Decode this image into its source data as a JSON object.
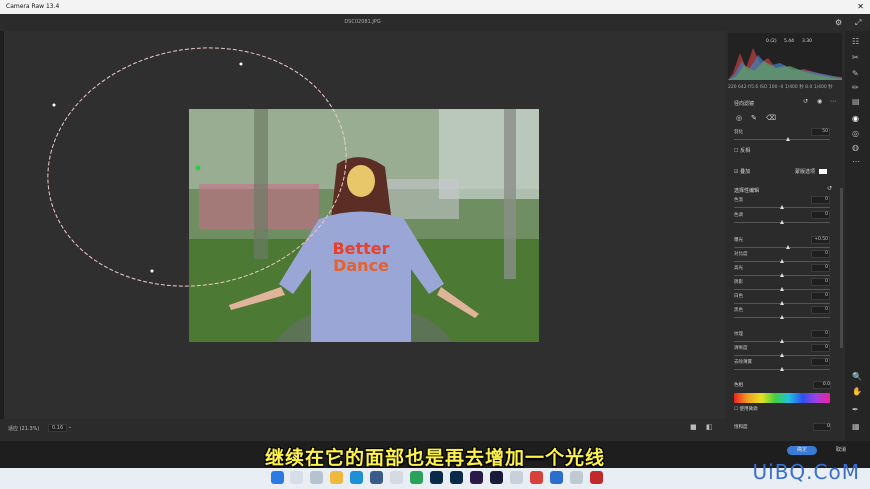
{
  "window": {
    "title": "Camera Raw 13.4",
    "close": "✕"
  },
  "file": {
    "name": "DSC02081.JPG"
  },
  "histogram": {
    "readout": [
      "0.(2)",
      "5.44",
      "3.30"
    ],
    "info": "220 642  f/5.6  ISO 100  -0 1/400 秒  8.0  1/400 秒"
  },
  "panel": {
    "title": "径向滤镜",
    "feather_label": "羽化",
    "feather_value": "50",
    "invert_label": "反相",
    "overlay_label": "叠加",
    "mask_label": "蒙版选项",
    "selective_title": "选择性编辑",
    "sliders": [
      {
        "label": "色温",
        "value": "0",
        "pos": 0.5
      },
      {
        "label": "色调",
        "value": "0",
        "pos": 0.5
      },
      {
        "label": "曝光",
        "value": "+0.50",
        "pos": 0.56
      },
      {
        "label": "对比度",
        "value": "0",
        "pos": 0.5
      },
      {
        "label": "高光",
        "value": "0",
        "pos": 0.5
      },
      {
        "label": "阴影",
        "value": "0",
        "pos": 0.5
      },
      {
        "label": "白色",
        "value": "0",
        "pos": 0.5
      },
      {
        "label": "黑色",
        "value": "0",
        "pos": 0.5
      },
      {
        "label": "纹理",
        "value": "0",
        "pos": 0.5
      },
      {
        "label": "清晰度",
        "value": "0",
        "pos": 0.5
      },
      {
        "label": "去除薄雾",
        "value": "0",
        "pos": 0.5
      }
    ],
    "hue_label": "色相",
    "hue_value": "0.0",
    "fine_label": "使用微调",
    "saturation_label": "饱和度",
    "saturation_value": "0"
  },
  "bottom": {
    "zoom_label": "适应 (21.3%)",
    "zoom_value": "0.16"
  },
  "buttons": {
    "ok": "确定",
    "cancel": "取消"
  },
  "subtitle": "继续在它的面部也是再去增加一个光线",
  "watermark": "UiBQ.CoM",
  "photo_text": {
    "line1": "Better",
    "line2": "Dance"
  },
  "colors": {
    "subtitle": "#fff34a",
    "watermark": "#3a6fd0",
    "accent": "#3a7bd5"
  }
}
